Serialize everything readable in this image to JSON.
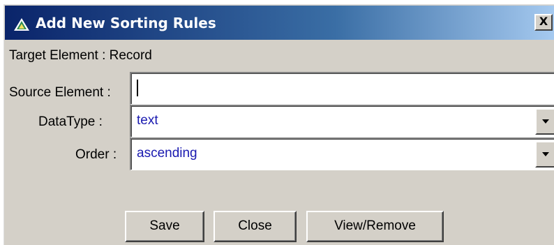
{
  "dialog": {
    "title": "Add New Sorting Rules",
    "close_label": "X"
  },
  "target_element": {
    "text": "Target Element : Record"
  },
  "source_element": {
    "label": "Source Element :",
    "value": ""
  },
  "data_type": {
    "label": "DataType :",
    "selected": "text"
  },
  "order": {
    "label": "Order :",
    "selected": "ascending"
  },
  "buttons": {
    "save": "Save",
    "close": "Close",
    "view_remove": "View/Remove"
  },
  "colors": {
    "title_bar_start": "#0a246a",
    "title_bar_end": "#a6caf0",
    "dialog_face": "#d4d0c8",
    "field_text": "#1a1ab0"
  },
  "icons": {
    "title": "app-logo-icon",
    "dropdown": "chevron-down-icon"
  }
}
